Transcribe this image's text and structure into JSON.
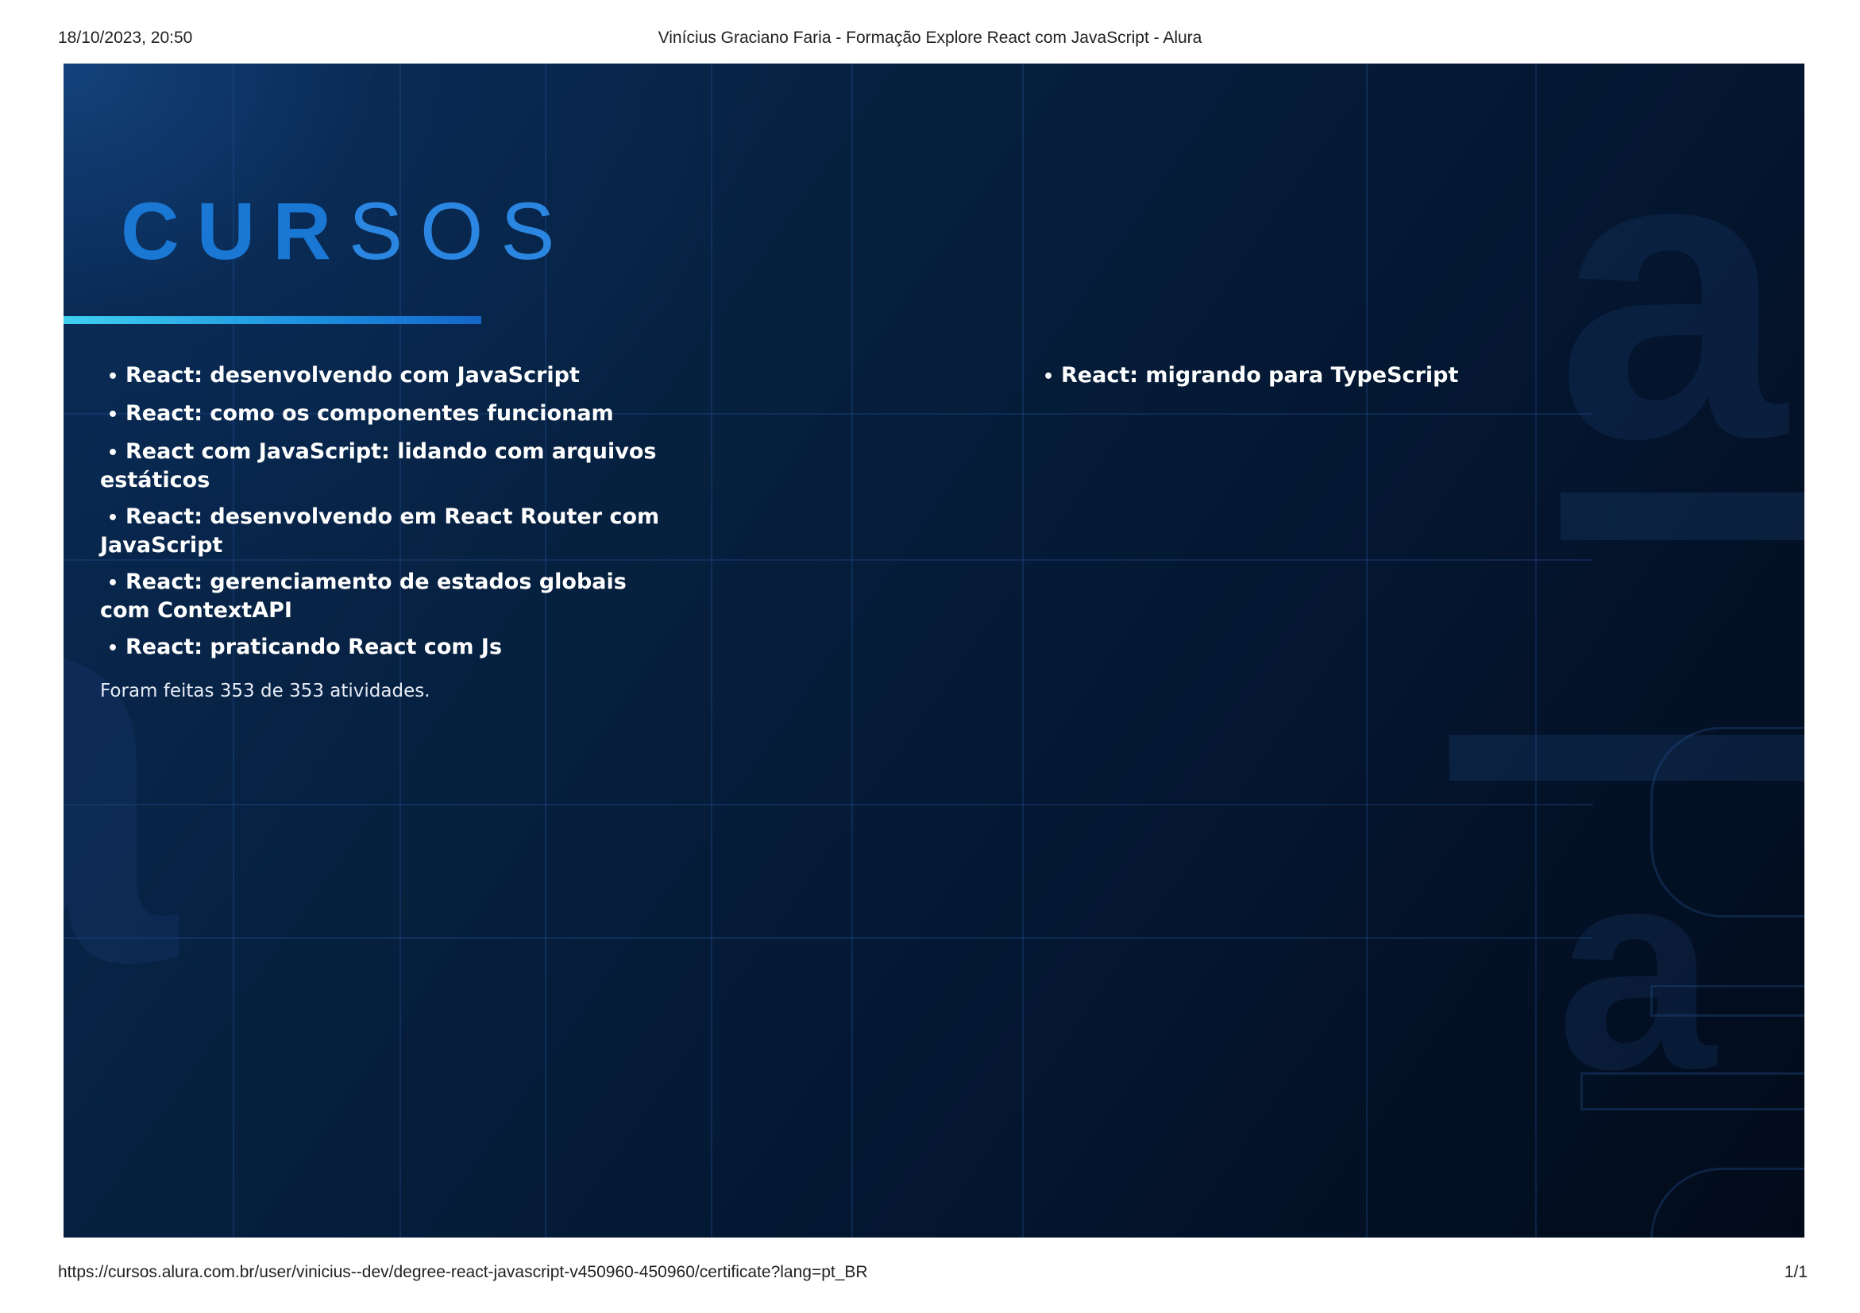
{
  "print_header": {
    "datetime": "18/10/2023, 20:50",
    "title": "Vinícius Graciano Faria - Formação Explore React com JavaScript - Alura"
  },
  "print_footer": {
    "url": "https://cursos.alura.com.br/user/vinicius--dev/degree-react-javascript-v450960-450960/certificate?lang=pt_BR",
    "page": "1/1"
  },
  "certificate": {
    "section_title_bold": "CUR",
    "section_title_light": "SOS",
    "courses_left": [
      "React: desenvolvendo com JavaScript",
      "React: como os componentes funcionam",
      "React com JavaScript: lidando com arquivos estáticos",
      "React: desenvolvendo em React Router com JavaScript",
      "React: gerenciamento de estados globais com ContextAPI",
      "React: praticando React com Js"
    ],
    "courses_right": [
      "React: migrando para TypeScript"
    ],
    "activities_text": "Foram feitas 353 de 353 atividades.",
    "watermark_text": "alura",
    "colors": {
      "background_dark": "#041630",
      "title_blue": "#1a77d4",
      "accent_cyan": "#3fd0f0",
      "text": "#ffffff"
    }
  }
}
